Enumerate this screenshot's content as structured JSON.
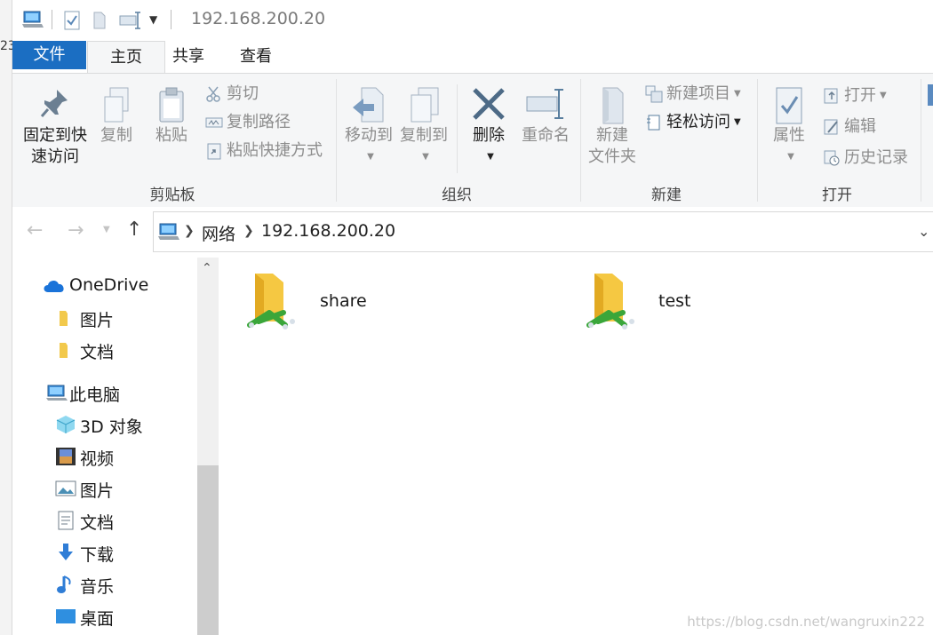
{
  "window": {
    "title": "192.168.200.20",
    "edge_text": "23"
  },
  "tabs": [
    {
      "label": "文件"
    },
    {
      "label": "主页"
    },
    {
      "label": "共享"
    },
    {
      "label": "查看"
    }
  ],
  "ribbon": {
    "clipboard": {
      "pin_label_1": "固定到快",
      "pin_label_2": "速访问",
      "copy_label": "复制",
      "paste_label": "粘贴",
      "cut_label": "剪切",
      "copy_path_label": "复制路径",
      "paste_shortcut_label": "粘贴快捷方式",
      "group_label": "剪贴板"
    },
    "organize": {
      "move_label": "移动到",
      "copyto_label": "复制到",
      "delete_label": "删除",
      "rename_label": "重命名",
      "group_label": "组织"
    },
    "new": {
      "new_folder_1": "新建",
      "new_folder_2": "文件夹",
      "new_item_label": "新建项目",
      "easy_access_label": "轻松访问",
      "group_label": "新建"
    },
    "open": {
      "properties_label": "属性",
      "open_label": "打开",
      "edit_label": "编辑",
      "history_label": "历史记录",
      "group_label": "打开"
    }
  },
  "address": {
    "crumbs": [
      "网络",
      "192.168.200.20"
    ]
  },
  "sidebar": {
    "items": [
      {
        "label": "OneDrive",
        "icon": "cloud-icon"
      },
      {
        "label": "图片",
        "icon": "folder-icon"
      },
      {
        "label": "文档",
        "icon": "folder-icon"
      },
      {
        "label": "此电脑",
        "icon": "computer-icon"
      },
      {
        "label": "3D 对象",
        "icon": "cube-icon"
      },
      {
        "label": "视频",
        "icon": "film-icon"
      },
      {
        "label": "图片",
        "icon": "picture-icon"
      },
      {
        "label": "文档",
        "icon": "document-icon"
      },
      {
        "label": "下载",
        "icon": "download-icon"
      },
      {
        "label": "音乐",
        "icon": "music-icon"
      },
      {
        "label": "桌面",
        "icon": "desktop-icon"
      }
    ]
  },
  "content": {
    "folders": [
      {
        "name": "share"
      },
      {
        "name": "test"
      }
    ]
  },
  "watermark": "https://blog.csdn.net/wangruxin222",
  "colors": {
    "accent": "#1b6ec2",
    "ribbon_bg": "#f5f6f7"
  }
}
